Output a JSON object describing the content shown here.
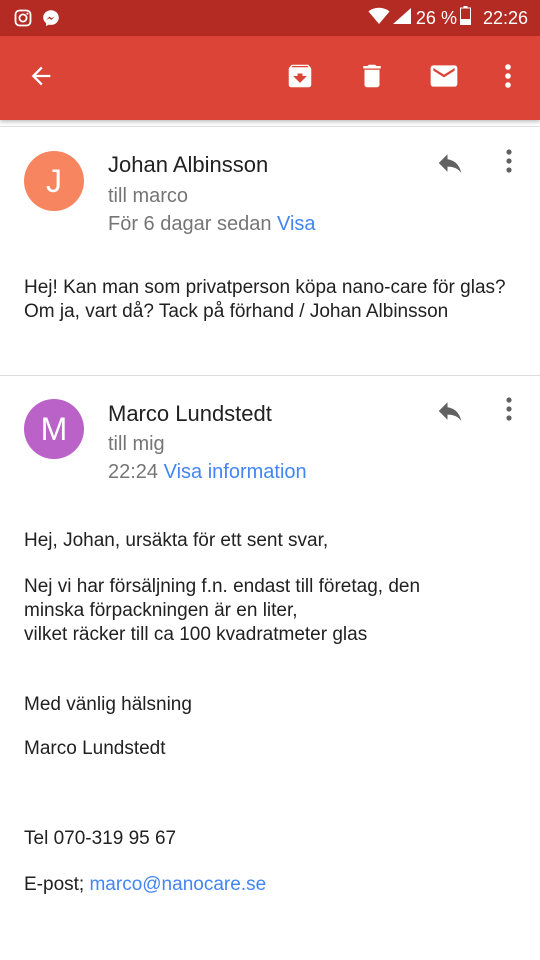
{
  "status_bar": {
    "battery": "26 %",
    "time": "22:26",
    "icons": [
      "instagram-icon",
      "messenger-icon",
      "wifi-icon",
      "signal-icon",
      "battery-icon"
    ]
  },
  "toolbar": {
    "icons": [
      "back-arrow-icon",
      "archive-icon",
      "trash-icon",
      "mail-icon",
      "more-vert-icon"
    ]
  },
  "messages": [
    {
      "avatar_letter": "J",
      "avatar_color": "#f7855f",
      "sender": "Johan Albinsson",
      "recipient": "till marco",
      "time": "För 6 dagar sedan",
      "details_link": "Visa",
      "body": "Hej! Kan man som privatperson köpa nano-care för glas? Om ja, vart då? Tack på förhand / Johan Albinsson"
    },
    {
      "avatar_letter": "M",
      "avatar_color": "#bb62c9",
      "sender": "Marco Lundstedt",
      "recipient": "till mig",
      "time": "22:24",
      "details_link": "Visa information",
      "body_lines": [
        "Hej, Johan, ursäkta för ett sent svar,",
        "Nej vi har försäljning f.n. endast till företag, den",
        "minska förpackningen är en liter,",
        "vilket räcker till ca 100 kvadratmeter glas",
        "Med vänlig hälsning",
        "Marco Lundstedt",
        "Tel 070-319 95 67"
      ],
      "email_label": "E-post;",
      "email": "marco@nanocare.se"
    }
  ],
  "colors": {
    "status_bar": "#b42b23",
    "app_bar": "#db4437",
    "link": "#4285f4"
  }
}
